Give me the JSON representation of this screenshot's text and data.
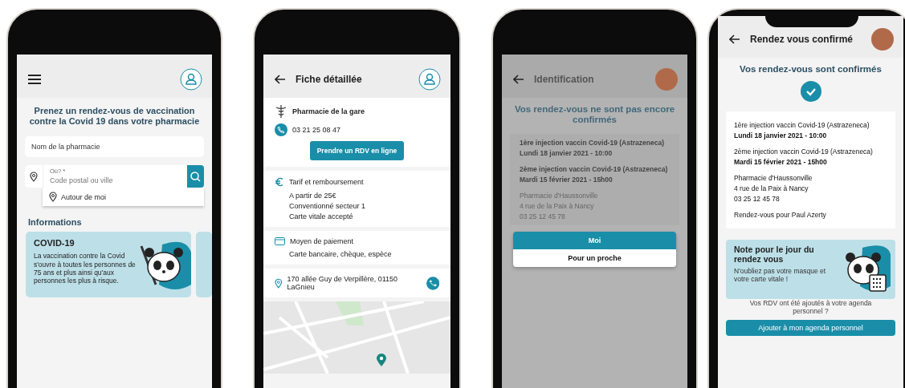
{
  "screens": [
    {
      "kind": "search",
      "dimmed": false,
      "heading": "Prenez un rendez-vous de vaccination contre la Covid 19 dans votre pharmacie",
      "pharmacy_field": {
        "placeholder": "Nom de la pharmacie"
      },
      "location_field": {
        "label": "Où? *",
        "placeholder": "Code postal ou ville"
      },
      "suggestion": "Autour de moi",
      "section_title": "Informations",
      "info_card": {
        "title": "COVID-19",
        "text": "La vaccination contre la Covid s'ouvre à toutes les personnes de 75 ans et plus ainsi qu'aux personnes les plus à risque."
      }
    },
    {
      "kind": "detail",
      "dimmed": false,
      "title": "Fiche détaillée",
      "pharmacy_name": "Pharmacie de la gare",
      "phone": "03 21 25 08 47",
      "cta": "Prendre un RDV en ligne",
      "sections": [
        {
          "kind": "euro",
          "title": "Tarif et remboursement",
          "lines": [
            "A partir de 25€",
            "Conventionné secteur 1",
            "Carte vitale accepté"
          ]
        },
        {
          "kind": "card",
          "title": "Moyen de paiement",
          "lines": [
            "Carte bancaire, chèque, espèce"
          ]
        }
      ],
      "address": "170 allée Guy de Verpillère, 01150 LaGnieu"
    },
    {
      "kind": "identification",
      "dimmed": true,
      "title": "Identification",
      "heading": "Vos rendez-vous ne sont pas encore confirmés",
      "appointments": [
        {
          "name": "1ère injection vaccin Covid-19 (Astrazeneca)",
          "date": "Lundi 18 janvier 2021 - 10:00"
        },
        {
          "name": "2ème injection vaccin Covid-19 (Astrazeneca)",
          "date": "Mardi 15 février 2021 - 15h00"
        }
      ],
      "pharmacy_lines": [
        "Pharmacie d'Haussonville",
        "4 rue de la Paix à Nancy",
        "03 25 12 45 78"
      ],
      "options": [
        {
          "label": "Moi",
          "selected": true
        },
        {
          "label": "Pour un proche",
          "selected": false
        }
      ]
    },
    {
      "kind": "confirmed",
      "dimmed": false,
      "title": "Rendez vous confirmé",
      "heading": "Vos rendez-vous sont confirmés",
      "appointments": [
        {
          "name": "1ère injection vaccin Covid-19 (Astrazeneca)",
          "date": "Lundi 18 janvier 2021 - 10:00"
        },
        {
          "name": "2ème injection vaccin Covid-19 (Astrazeneca)",
          "date": "Mardi 15 février 2021 - 15h00"
        }
      ],
      "pharmacy_lines": [
        "Pharmacie d'Haussonville",
        "4 rue de la Paix à Nancy",
        "03 25 12 45 78"
      ],
      "for_whom": "Rendez-vous pour Paul Azerty",
      "note": {
        "title": "Note pour le jour du rendez vous",
        "text": "N'oubliez pas votre masque et votre carte vitale !"
      },
      "agenda_lines": [
        "Vos RDV ont été ajoutés à votre agenda",
        "personnel ?"
      ],
      "agenda_button": "Ajouter à mon agenda personnel"
    }
  ]
}
